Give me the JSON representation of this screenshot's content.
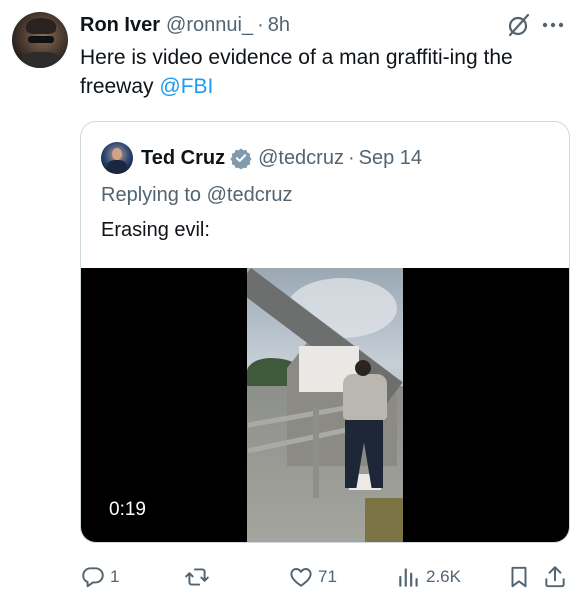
{
  "tweet": {
    "author_name": "Ron Iver",
    "author_handle": "@ronnui_",
    "separator": "·",
    "time": "8h",
    "text_before": "Here is video evidence of a man graffiti-ing the freeway",
    "mention": "@FBI"
  },
  "quoted_tweet": {
    "author_name": "Ted Cruz",
    "author_handle": "@tedcruz",
    "separator": "·",
    "date": "Sep 14",
    "replying_to": "Replying to @tedcruz",
    "text": "Erasing evil:",
    "video_duration": "0:19"
  },
  "actions": {
    "replies": "1",
    "reposts": "",
    "likes": "71",
    "views": "2.6K"
  },
  "icons": {
    "more": "more-horizontal-icon",
    "grok": "grok-slash-icon",
    "reply": "reply-icon",
    "repost": "repost-icon",
    "like": "heart-icon",
    "views": "views-icon",
    "bookmark": "bookmark-icon",
    "share": "share-icon",
    "verified": "verified-badge-icon"
  },
  "colors": {
    "link": "#1d9bf0",
    "muted": "#536471",
    "text": "#0f1419",
    "border": "#cfd9de"
  }
}
